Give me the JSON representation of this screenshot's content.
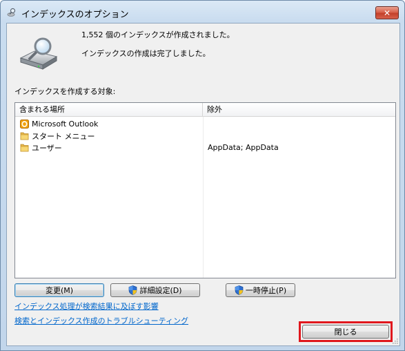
{
  "window": {
    "title": "インデックスのオプション",
    "close_glyph": "✕"
  },
  "status": {
    "count_message": "1,552 個のインデックスが作成されました。",
    "complete_message": "インデックスの作成は完了しました。"
  },
  "target_label": "インデックスを作成する対象:",
  "list": {
    "columns": [
      "含まれる場所",
      "除外"
    ],
    "rows": [
      {
        "name": "Microsoft Outlook",
        "excluded": "",
        "icon": "outlook-icon"
      },
      {
        "name": "スタート メニュー",
        "excluded": "",
        "icon": "folder-icon"
      },
      {
        "name": "ユーザー",
        "excluded": "AppData; AppData",
        "icon": "folder-icon"
      }
    ]
  },
  "buttons": {
    "modify": "変更(M)",
    "advanced": "詳細設定(D)",
    "pause": "一時停止(P)",
    "close": "閉じる"
  },
  "links": {
    "affect_results": "インデックス処理が検索結果に及ぼす影響",
    "troubleshoot": "検索とインデックス作成のトラブルシューティング"
  },
  "colors": {
    "link": "#0066cc",
    "highlight": "#e0171d"
  }
}
